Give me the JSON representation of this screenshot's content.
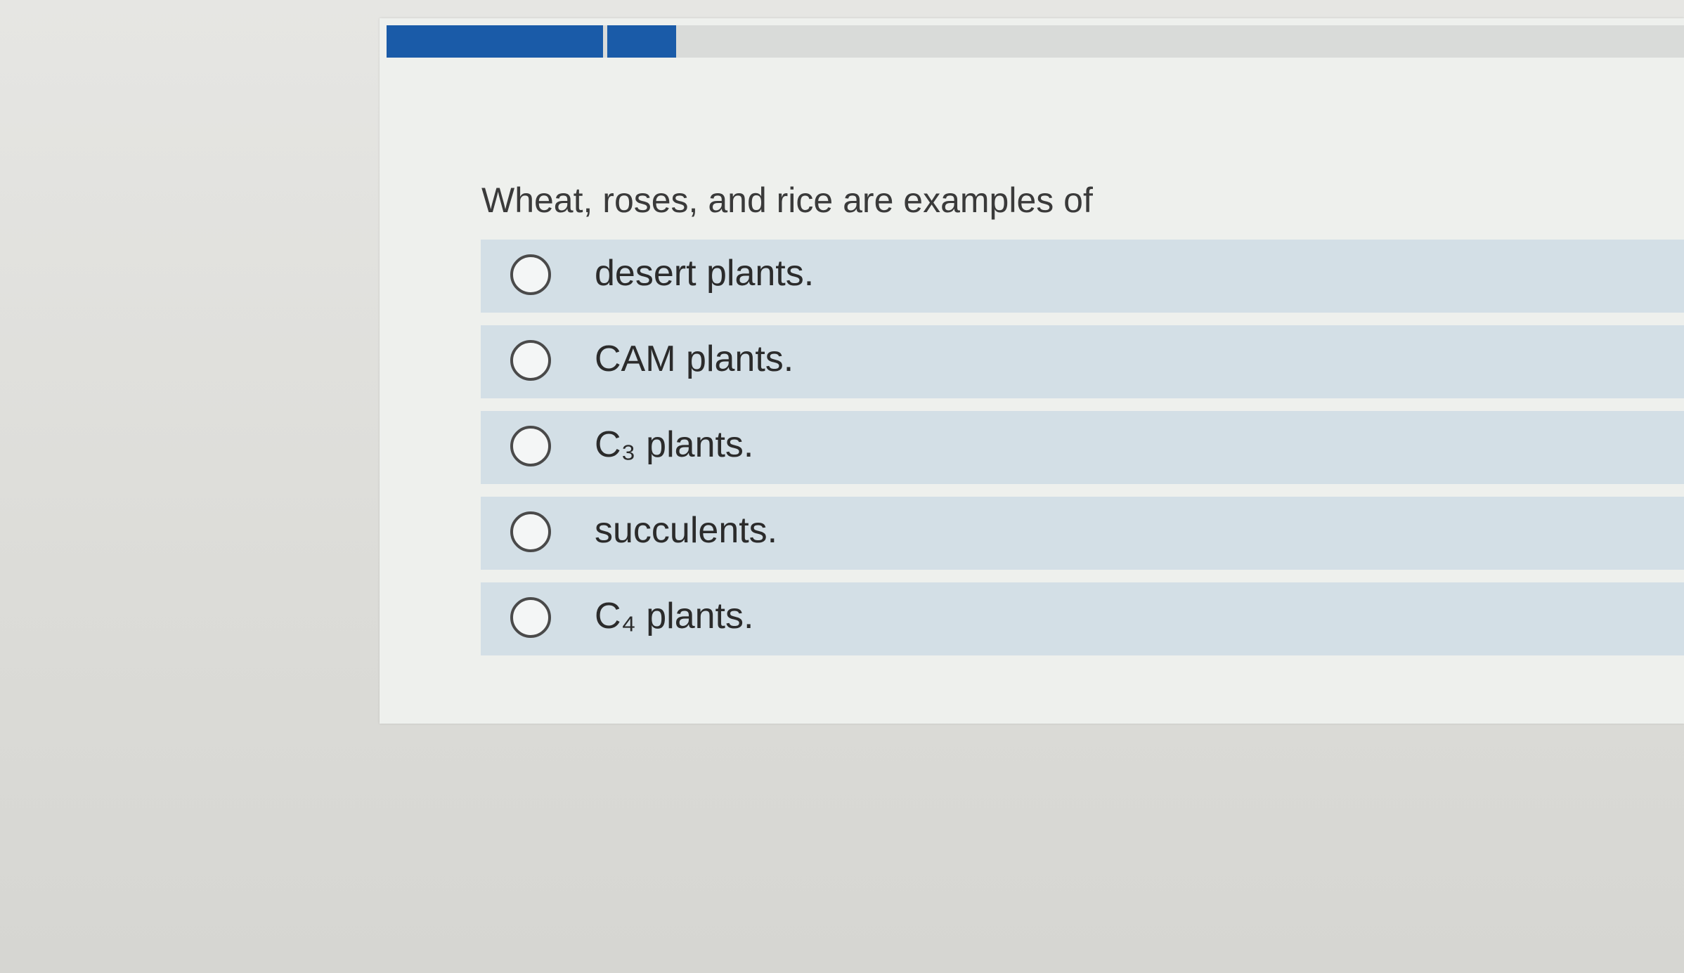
{
  "quiz": {
    "progress": {
      "segments_filled": 2
    },
    "question": "Wheat, roses, and rice are examples of",
    "options": [
      {
        "label": "desert plants."
      },
      {
        "label": "CAM plants."
      },
      {
        "label": "C₃ plants."
      },
      {
        "label": "succulents."
      },
      {
        "label": "C₄ plants."
      }
    ]
  },
  "colors": {
    "progress_fill": "#1a5ba8",
    "option_bg": "#d3dfe6",
    "card_bg": "#eef0ed"
  }
}
